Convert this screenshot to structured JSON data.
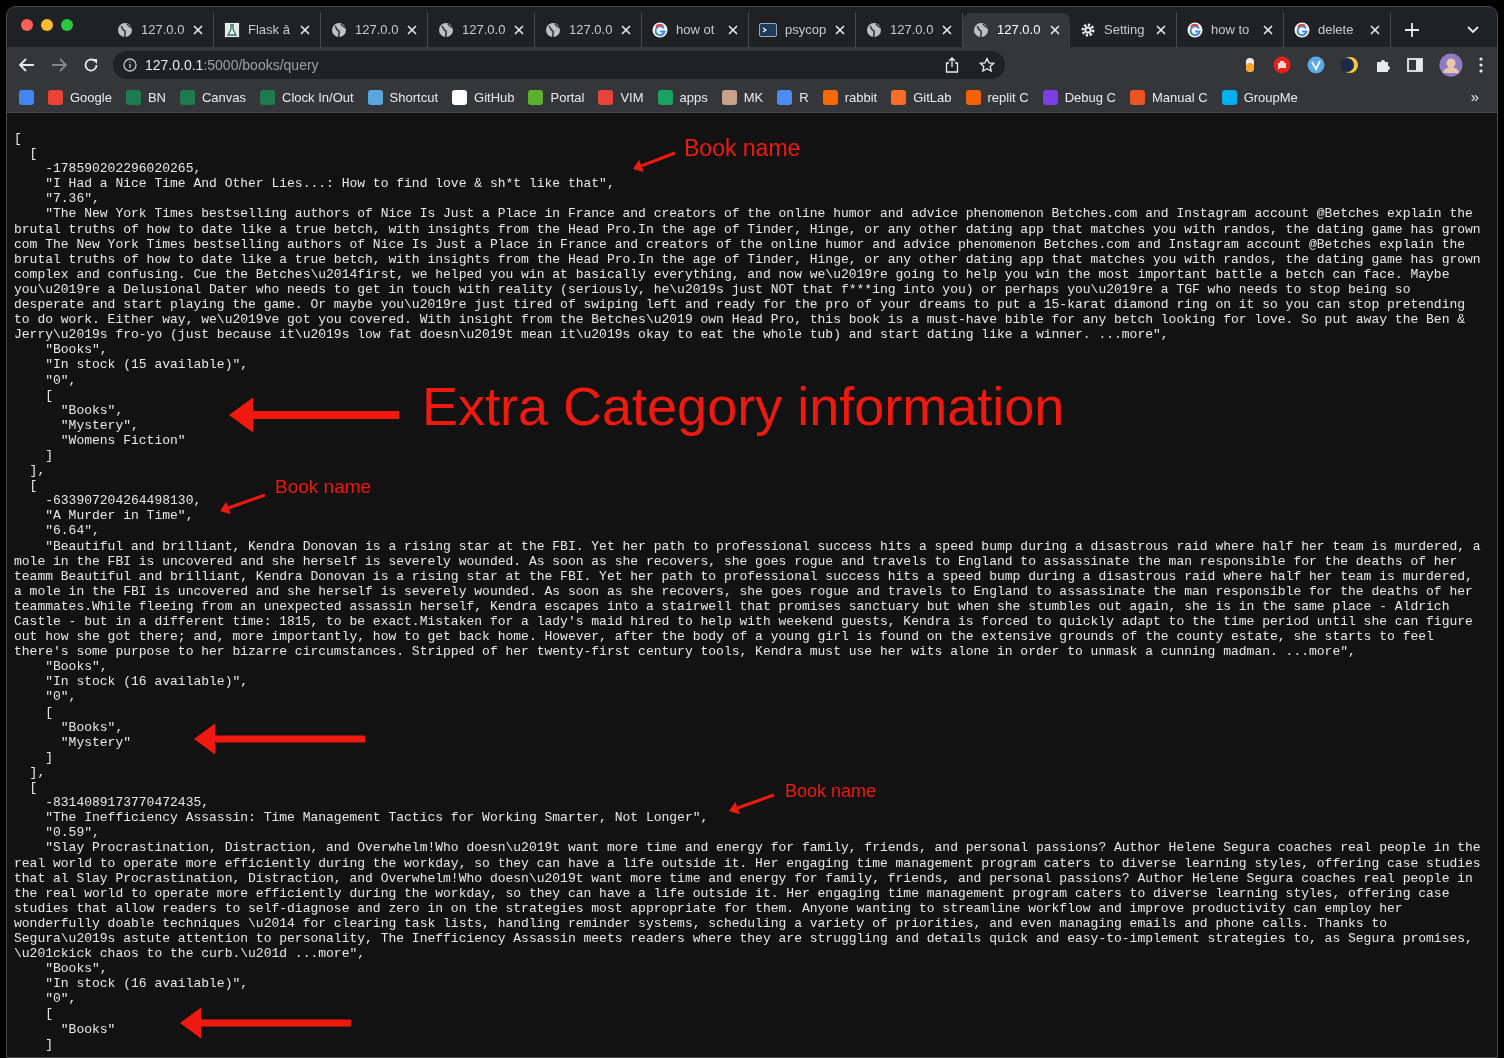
{
  "tabs": [
    {
      "kind": "globe",
      "title": "127.0.0",
      "selected": false
    },
    {
      "kind": "flask",
      "title": "Flask â",
      "selected": false
    },
    {
      "kind": "globe",
      "title": "127.0.0",
      "selected": false
    },
    {
      "kind": "globe",
      "title": "127.0.0",
      "selected": false
    },
    {
      "kind": "globe",
      "title": "127.0.0",
      "selected": false
    },
    {
      "kind": "google",
      "title": "how ot",
      "selected": false
    },
    {
      "kind": "terminal",
      "title": "psycop",
      "selected": false
    },
    {
      "kind": "globe",
      "title": "127.0.0",
      "selected": false
    },
    {
      "kind": "globe",
      "title": "127.0.0",
      "selected": true
    },
    {
      "kind": "gear",
      "title": "Setting",
      "selected": false
    },
    {
      "kind": "google",
      "title": "how to",
      "selected": false
    },
    {
      "kind": "google",
      "title": "delete",
      "selected": false
    }
  ],
  "address": {
    "host": "127.0.0.1",
    "path": ":5000/books/query"
  },
  "bookmarks": [
    {
      "color": "#4285f4"
    },
    {
      "label": "Google",
      "color": "#ea4335"
    },
    {
      "label": "BN",
      "color": "#1e7b4f"
    },
    {
      "label": "Canvas",
      "color": "#1e7b4f"
    },
    {
      "label": "Clock In/Out",
      "color": "#1e7b4f"
    },
    {
      "label": "Shortcut",
      "color": "#58a6dd"
    },
    {
      "label": "GitHub",
      "color": "#ffffff"
    },
    {
      "label": "Portal",
      "color": "#5cb030"
    },
    {
      "label": "VIM",
      "color": "#e5453a"
    },
    {
      "label": "apps",
      "color": "#1aa260"
    },
    {
      "label": "MK",
      "color": "#c9a28b"
    },
    {
      "label": "R",
      "color": "#4c8bf5"
    },
    {
      "label": "rabbit",
      "color": "#f76808"
    },
    {
      "label": "GitLab",
      "color": "#fc6d26"
    },
    {
      "label": "replit C",
      "color": "#f26207"
    },
    {
      "label": "Debug C",
      "color": "#7b3fe4"
    },
    {
      "label": "Manual C",
      "color": "#e95420"
    },
    {
      "label": "GroupMe",
      "color": "#00aff0"
    }
  ],
  "bookmarks_more": "»",
  "lines": [
    "[",
    "  [",
    "    -178590202296020265,",
    "    \"I Had a Nice Time And Other Lies...: How to find love & sh*t like that\",",
    "    \"7.36\",",
    "    \"The New York Times bestselling authors of Nice Is Just a Place in France and creators of the online humor and advice phenomenon Betches.com and Instagram account @Betches explain the",
    "brutal truths of how to date like a true betch, with insights from the Head Pro.In the age of Tinder, Hinge, or any other dating app that matches you with randos, the dating game has grown",
    "com The New York Times bestselling authors of Nice Is Just a Place in France and creators of the online humor and advice phenomenon Betches.com and Instagram account @Betches explain the",
    "brutal truths of how to date like a true betch, with insights from the Head Pro.In the age of Tinder, Hinge, or any other dating app that matches you with randos, the dating game has grown",
    "complex and confusing. Cue the Betches\\u2014first, we helped you win at basically everything, and now we\\u2019re going to help you win the most important battle a betch can face. Maybe",
    "you\\u2019re a Delusional Dater who needs to get in touch with reality (seriously, he\\u2019s just NOT that f***ing into you) or perhaps you\\u2019re a TGF who needs to stop being so",
    "desperate and start playing the game. Or maybe you\\u2019re just tired of swiping left and ready for the pro of your dreams to put a 15-karat diamond ring on it so you can stop pretending",
    "to do work. Either way, we\\u2019ve got you covered. With insight from the Betches\\u2019 own Head Pro, this book is a must-have bible for any betch looking for love. So put away the Ben &",
    "Jerry\\u2019s fro-yo (just because it\\u2019s low fat doesn\\u2019t mean it\\u2019s okay to eat the whole tub) and start dating like a winner. ...more\",",
    "    \"Books\",",
    "    \"In stock (15 available)\",",
    "    \"0\",",
    "    [",
    "      \"Books\",",
    "      \"Mystery\",",
    "      \"Womens Fiction\"",
    "    ]",
    "  ],",
    "  [",
    "    -633907204264498130,",
    "    \"A Murder in Time\",",
    "    \"6.64\",",
    "    \"Beautiful and brilliant, Kendra Donovan is a rising star at the FBI. Yet her path to professional success hits a speed bump during a disastrous raid where half her team is murdered, a",
    "mole in the FBI is uncovered and she herself is severely wounded. As soon as she recovers, she goes rogue and travels to England to assassinate the man responsible for the deaths of her",
    "teamm Beautiful and brilliant, Kendra Donovan is a rising star at the FBI. Yet her path to professional success hits a speed bump during a disastrous raid where half her team is murdered,",
    "a mole in the FBI is uncovered and she herself is severely wounded. As soon as she recovers, she goes rogue and travels to England to assassinate the man responsible for the deaths of her",
    "teammates.While fleeing from an unexpected assassin herself, Kendra escapes into a stairwell that promises sanctuary but when she stumbles out again, she is in the same place - Aldrich",
    "Castle - but in a different time: 1815, to be exact.Mistaken for a lady's maid hired to help with weekend guests, Kendra is forced to quickly adapt to the time period until she can figure",
    "out how she got there; and, more importantly, how to get back home. However, after the body of a young girl is found on the extensive grounds of the county estate, she starts to feel",
    "there's some purpose to her bizarre circumstances. Stripped of her twenty-first century tools, Kendra must use her wits alone in order to unmask a cunning madman. ...more\",",
    "    \"Books\",",
    "    \"In stock (16 available)\",",
    "    \"0\",",
    "    [",
    "      \"Books\",",
    "      \"Mystery\"",
    "    ]",
    "  ],",
    "  [",
    "    -8314089173770472435,",
    "    \"The Inefficiency Assassin: Time Management Tactics for Working Smarter, Not Longer\",",
    "    \"0.59\",",
    "    \"Slay Procrastination, Distraction, and Overwhelm!Who doesn\\u2019t want more time and energy for family, friends, and personal passions? Author Helene Segura coaches real people in the",
    "real world to operate more efficiently during the workday, so they can have a life outside it. Her engaging time management program caters to diverse learning styles, offering case studies",
    "that al Slay Procrastination, Distraction, and Overwhelm!Who doesn\\u2019t want more time and energy for family, friends, and personal passions? Author Helene Segura coaches real people in",
    "the real world to operate more efficiently during the workday, so they can have a life outside it. Her engaging time management program caters to diverse learning styles, offering case",
    "studies that allow readers to self-diagnose and zero in on the strategies most appropriate for them. Anyone wanting to streamline workflow and improve productivity can employ her",
    "wonderfully doable techniques \\u2014 for clearing task lists, handling reminder systems, scheduling a variety of priorities, and even managing emails and phone calls. Thanks to",
    "Segura\\u2019s astute attention to personality, The Inefficiency Assassin meets readers where they are struggling and details quick and easy-to-implement strategies to, as Segura promises,",
    "\\u201ckick chaos to the curb.\\u201d ...more\",",
    "    \"Books\",",
    "    \"In stock (16 available)\",",
    "    \"0\",",
    "    [",
    "      \"Books\"",
    "    ]"
  ],
  "annotations": [
    "Book name",
    "Extra Category information",
    "Book name",
    "Book name"
  ]
}
